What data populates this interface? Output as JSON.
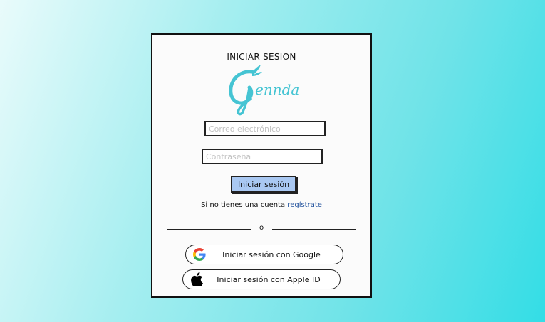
{
  "login": {
    "title": "INICIAR SESION",
    "logo_text": "Gennda",
    "email_placeholder": "Correo electrónico",
    "password_placeholder": "Contraseña",
    "login_button": "Iniciar sesión",
    "register_prompt": "Si no tienes una cuenta",
    "register_link": "regístrate",
    "divider_text": "o",
    "google_button": "Iniciar sesión con Google",
    "apple_button": "Iniciar sesión con Apple ID"
  },
  "colors": {
    "logo": "#45c4d3",
    "login_button": "#a9c8f2",
    "link": "#1e4f9b"
  },
  "icons": {
    "google": "google-icon",
    "apple": "apple-icon"
  }
}
